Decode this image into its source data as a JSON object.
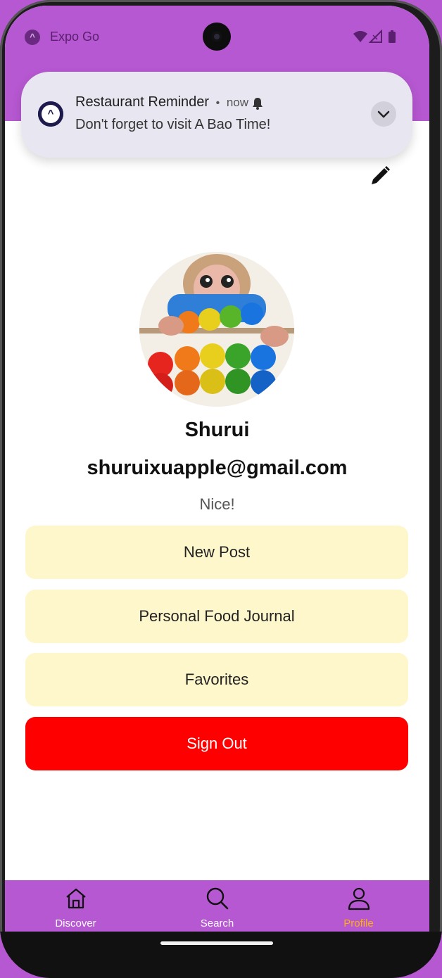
{
  "status_bar": {
    "app_name": "Expo Go",
    "app_icon": "expo-icon",
    "icons": [
      "wifi-icon",
      "signal-icon",
      "battery-icon"
    ]
  },
  "notification": {
    "title": "Restaurant Reminder",
    "separator": "•",
    "time": "now",
    "body": "Don't forget to visit A Bao Time!",
    "icons": [
      "expo-icon",
      "bell-icon",
      "chevron-down-icon"
    ]
  },
  "profile": {
    "name": "Shurui",
    "email": "shuruixuapple@gmail.com",
    "bio": "Nice!",
    "edit_icon": "pencil-icon"
  },
  "actions": {
    "new_post": "New Post",
    "food_journal": "Personal Food Journal",
    "favorites": "Favorites",
    "sign_out": "Sign Out"
  },
  "tabs": [
    {
      "label": "Discover",
      "icon": "home-icon"
    },
    {
      "label": "Search",
      "icon": "search-icon"
    },
    {
      "label": "Profile",
      "icon": "user-icon"
    }
  ],
  "colors": {
    "header": "#b658d1",
    "button_bg": "#fff7cc",
    "sign_out_bg": "#ff0000",
    "active_tab": "#ffb300"
  }
}
